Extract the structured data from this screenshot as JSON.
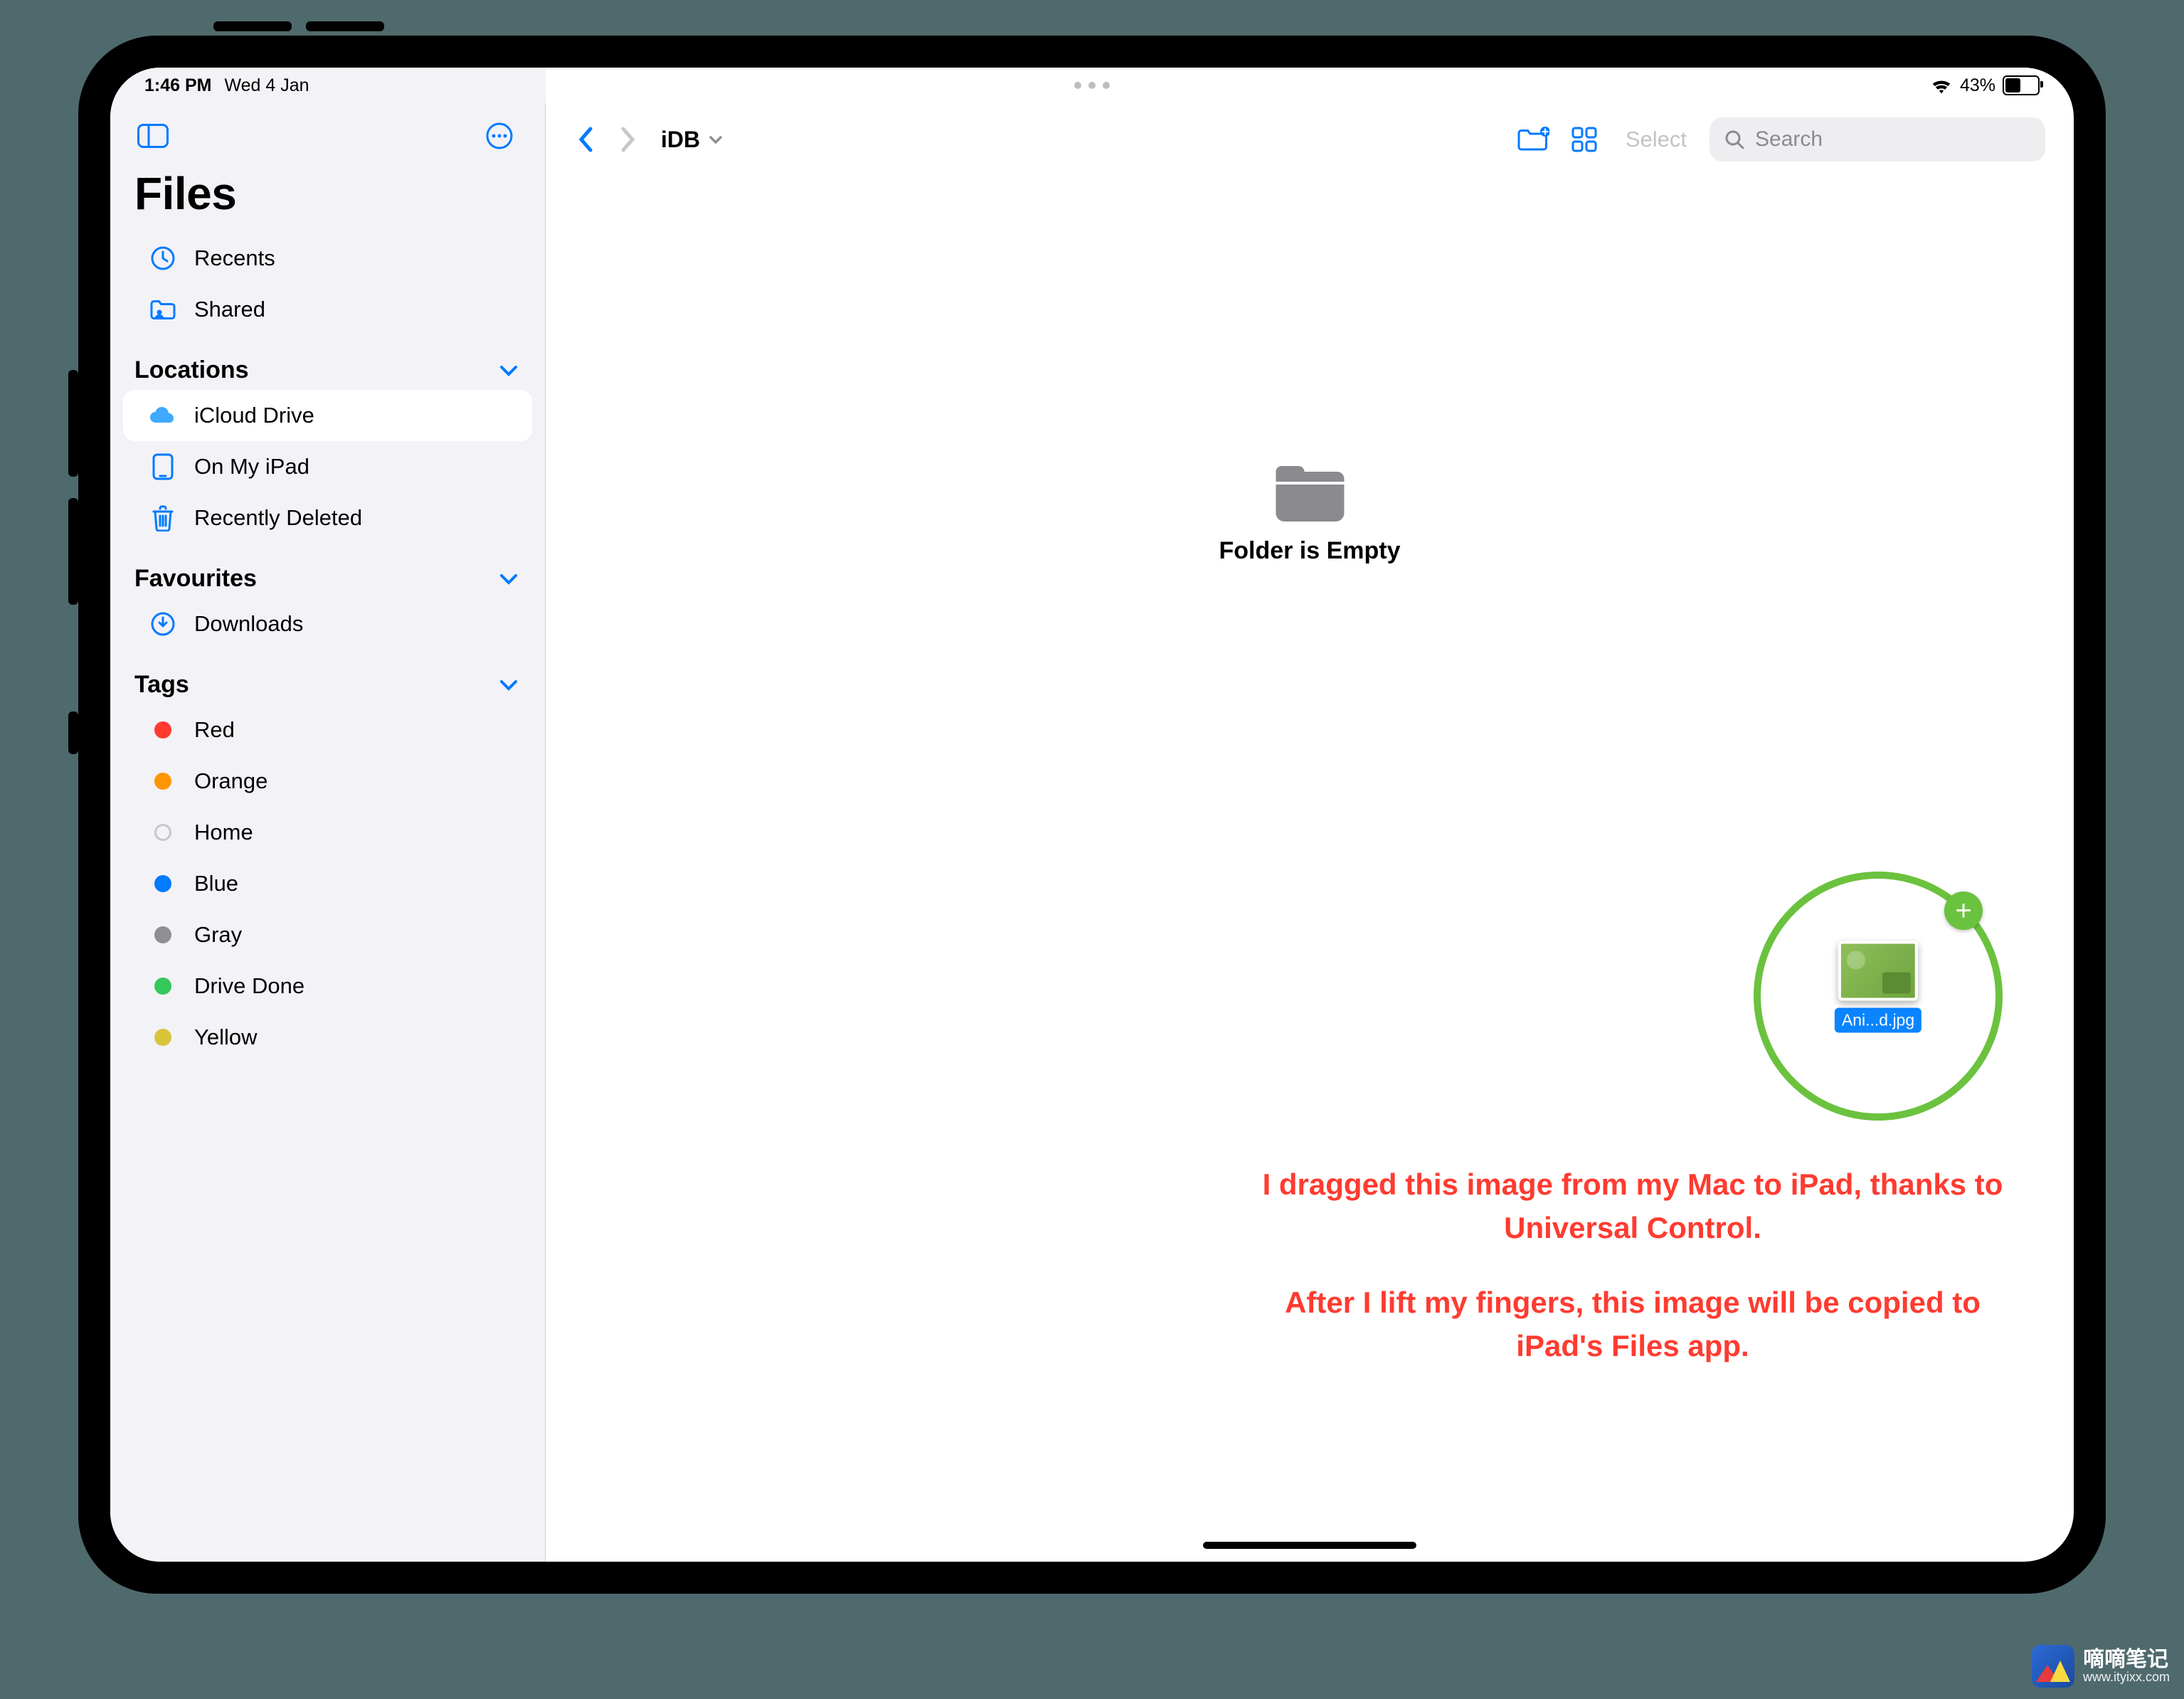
{
  "status": {
    "time": "1:46 PM",
    "date": "Wed 4 Jan",
    "battery_pct": "43%"
  },
  "app_title": "Files",
  "sidebar": {
    "recents": "Recents",
    "shared": "Shared",
    "sections": {
      "locations": "Locations",
      "favourites": "Favourites",
      "tags": "Tags"
    },
    "locations": [
      {
        "label": "iCloud Drive"
      },
      {
        "label": "On My iPad"
      },
      {
        "label": "Recently Deleted"
      }
    ],
    "favourites": [
      {
        "label": "Downloads"
      }
    ],
    "tags": [
      {
        "label": "Red",
        "color": "#ff3b30"
      },
      {
        "label": "Orange",
        "color": "#ff9500"
      },
      {
        "label": "Home",
        "color": "transparent",
        "hollow": true
      },
      {
        "label": "Blue",
        "color": "#007aff"
      },
      {
        "label": "Gray",
        "color": "#8e8e93"
      },
      {
        "label": "Drive Done",
        "color": "#34c759"
      },
      {
        "label": "Yellow",
        "color": "#d8c43a"
      }
    ]
  },
  "toolbar": {
    "breadcrumb": "iDB",
    "select": "Select",
    "search_placeholder": "Search"
  },
  "content": {
    "empty_label": "Folder is Empty",
    "drag_filename": "Ani...d.jpg"
  },
  "annotation": {
    "line1": "I dragged this image from my Mac to iPad, thanks to Universal Control.",
    "line2": "After I lift my fingers, this image will be copied to iPad's Files app."
  },
  "watermark": {
    "line1": "嘀嘀笔记",
    "line2": "www.ityixx.com"
  }
}
